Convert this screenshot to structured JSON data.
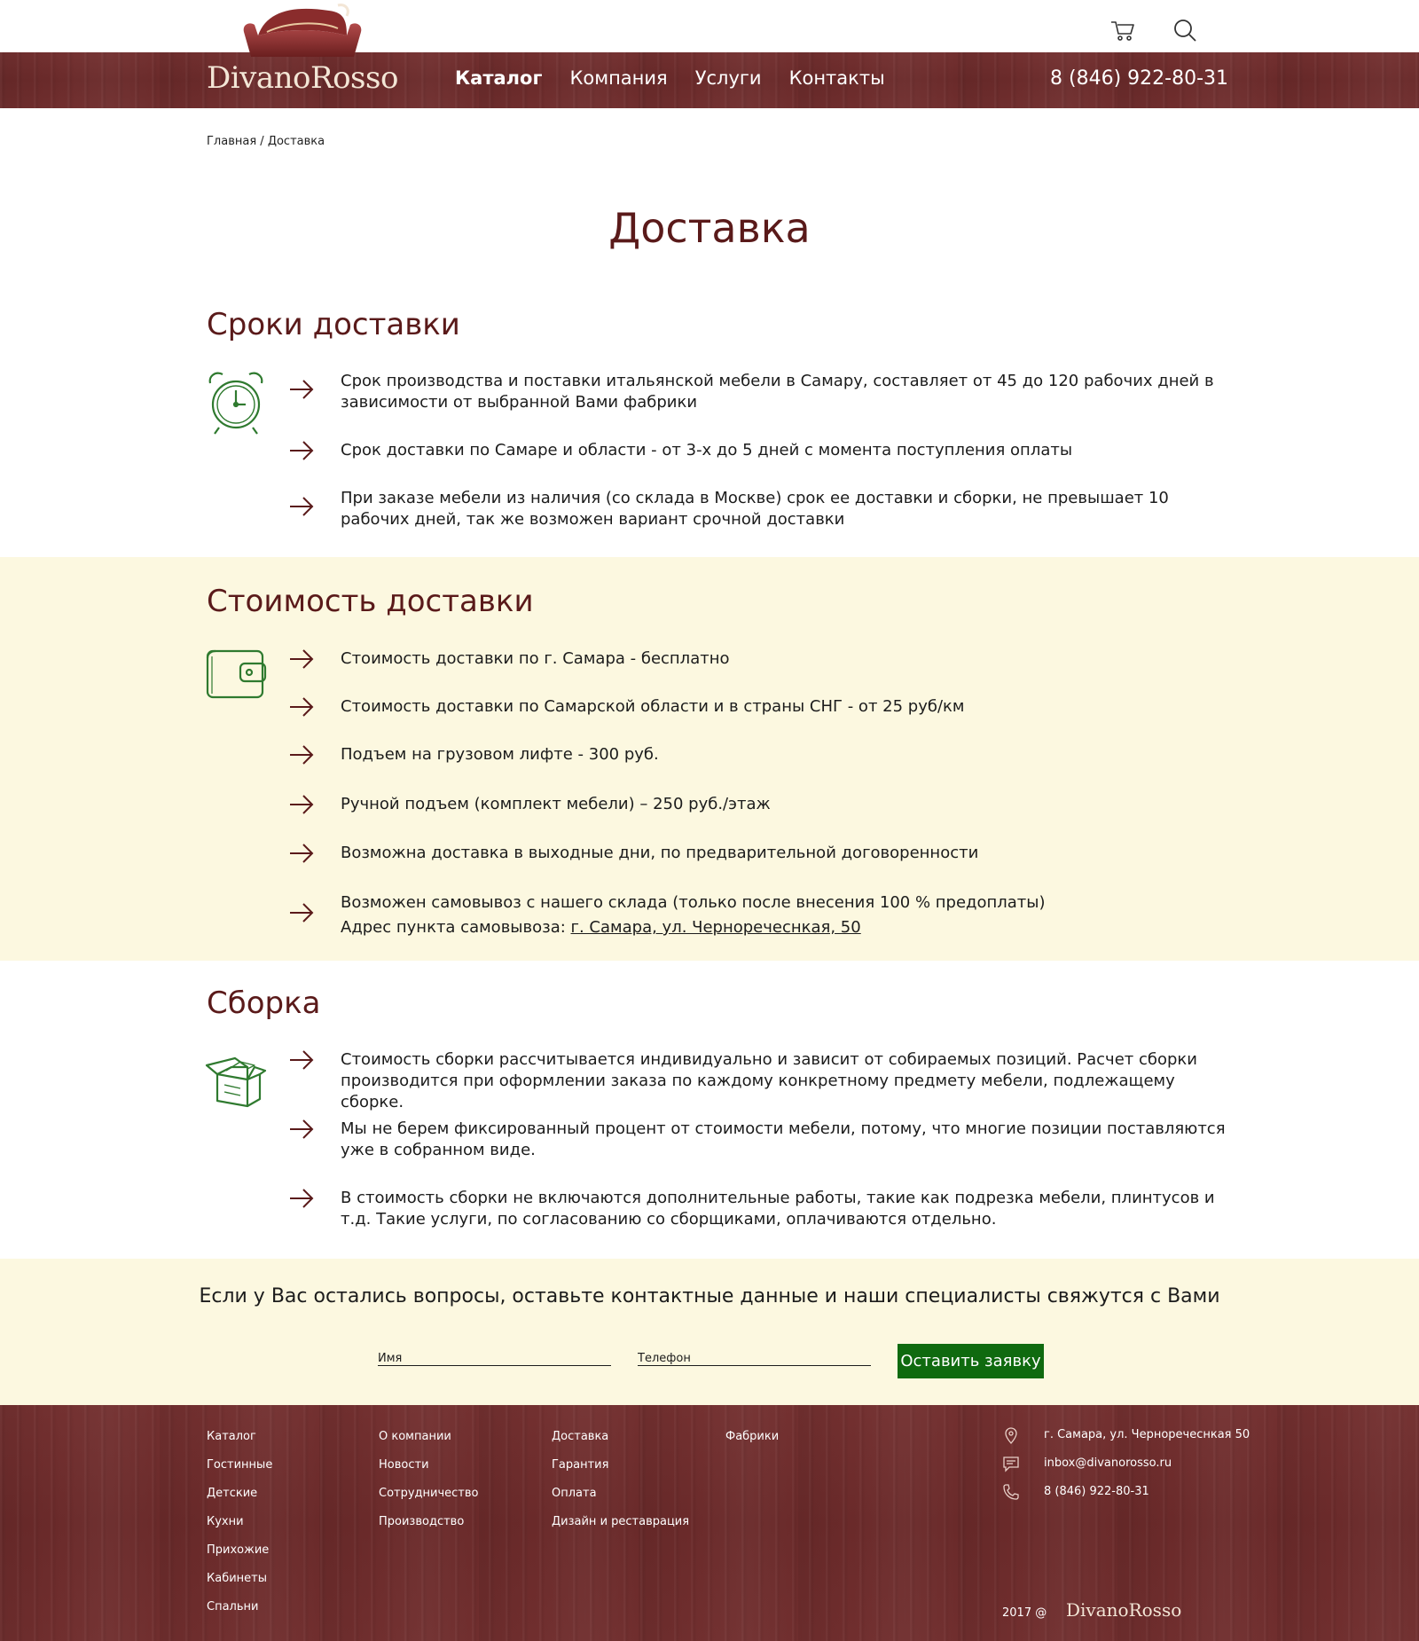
{
  "brand": {
    "name": "DivanoRosso"
  },
  "header": {
    "nav": [
      {
        "label": "Каталог",
        "active": true
      },
      {
        "label": "Компания",
        "active": false
      },
      {
        "label": "Услуги",
        "active": false
      },
      {
        "label": "Контакты",
        "active": false
      }
    ],
    "phone": "8 (846) 922-80-31",
    "icons": [
      "cart-icon",
      "search-icon"
    ]
  },
  "breadcrumb": {
    "home": "Главная",
    "separator": " / ",
    "current": "Доставка"
  },
  "page_title": "Доставка",
  "sections": {
    "timing": {
      "title": "Сроки доставки",
      "icon": "alarm-clock-icon",
      "items": [
        "Срок производства и поставки итальянской мебели в Самару, составляет от 45 до 120 рабочих дней в зависимости от выбранной Вами фабрики",
        "Срок доставки по Самаре  и области - от 3-х до 5 дней с момента поступления оплаты",
        "При заказе мебели из наличия (со склада в Москве) срок ее доставки и сборки, не превышает 10 рабочих дней, так же возможен вариант срочной доставки"
      ]
    },
    "cost": {
      "title": "Стоимость доставки",
      "icon": "wallet-icon",
      "items": [
        "Стоимость доставки по г. Самара - бесплатно",
        "Стоимость доставки по Самарской области и в страны СНГ - от 25 руб/км",
        "Подъем на грузовом лифте - 300 руб.",
        "Ручной подъем (комплект мебели) – 250 руб./этаж",
        "Возможна доставка в выходные дни, по предварительной договоренности",
        "Возможен самовывоз с нашего склада (только после внесения 100 % предоплаты)"
      ],
      "pickup_label": "Адрес пункта самовывоза: ",
      "pickup_address": "г. Самара, ул. Черноречеснкая, 50"
    },
    "assembly": {
      "title": "Сборка",
      "icon": "open-box-icon",
      "items": [
        "Стоимость сборки рассчитывается индивидуально и зависит от собираемых позиций. Расчет сборки производится при оформлении заказа  по каждому конкретному предмету мебели, подлежащему сборке.",
        "Мы не берем фиксированный процент от стоимости мебели, потому, что многие позиции поставляются уже в собранном виде.",
        "В стоимость сборки не включаются дополнительные работы, такие как подрезка мебели, плинтусов и т.д. Такие услуги, по согласованию со сборщиками, оплачиваются отдельно."
      ]
    }
  },
  "contact_form": {
    "title": "Если у Вас остались вопросы,  оставьте контактные данные и наши специалисты свяжутся с Вами",
    "name_placeholder": "Имя",
    "phone_placeholder": "Телефон",
    "submit_label": "Оставить заявку",
    "button_color": "#0f6a0f"
  },
  "footer": {
    "col1": [
      "Каталог",
      "Гостинные",
      "Детские",
      "Кухни",
      "Прихожие",
      "Кабинеты",
      "Спальни"
    ],
    "col2": [
      "О компании",
      "Новости",
      "Сотрудничество",
      "Производство"
    ],
    "col3": [
      "Доставка",
      "Гарантия",
      "Оплата",
      "Дизайн и реставрация"
    ],
    "col4": [
      "Фабрики"
    ],
    "contacts": {
      "address": "г. Самара, ул. Черноречеснкая 50",
      "email": "inbox@divanorosso.ru",
      "phone": "8 (846) 922-80-31"
    },
    "copyright": "2017 @",
    "logo": "DivanoRosso"
  },
  "colors": {
    "accent_dark_red": "#5a1a1a",
    "wood": "#6e2c2c",
    "cream": "#fcf8e0",
    "icon_green": "#2f7a2f"
  }
}
